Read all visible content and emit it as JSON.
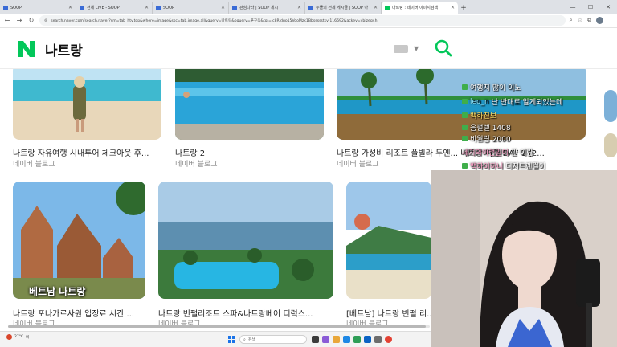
{
  "browser": {
    "tabs": [
      {
        "label": "SOOP",
        "favicon": "soop-icon",
        "active": false
      },
      {
        "label": "전체 LIVE - SOOP",
        "favicon": "soop-icon",
        "active": false
      },
      {
        "label": "SOOP",
        "favicon": "soop-icon",
        "active": false
      },
      {
        "label": "관심나라 | SOOP 게시",
        "favicon": "soop-icon",
        "active": false
      },
      {
        "label": "두들의 전체 게시글 | SOOP 아",
        "favicon": "soop-icon",
        "active": false
      },
      {
        "label": "나트랑 : 네이버 이미지검색",
        "favicon": "naver-icon",
        "active": true
      }
    ],
    "new_tab_label": "+",
    "url": "search.naver.com/search.naver?sm=tab_hty.top&where=image&ssc=tab.image.all&query=나트랑&oquery=푸꾸옥&tqi=jc8Rldqo15VooMzk1Bbssssstsv-116692&ackey=ybizeg4h"
  },
  "naver": {
    "logo": "N",
    "query": "나트랑",
    "brand_color": "#03c75a"
  },
  "results": [
    {
      "title": "나트랑 자유여행 시내투어 체크아웃 후...",
      "source": "네이버 블로그"
    },
    {
      "title": "나트랑 2",
      "source": "네이버 블로그"
    },
    {
      "title": "나트랑 가성비 리조트 풀빌라 두엔... 나트랑 여행 DAY 1 (2...",
      "source": "네이버 블로그"
    },
    {
      "title": "나트랑 포나가르사원 입장료 시간 ...",
      "source": "네이버 블로그",
      "overlay": "베트남 나트랑"
    },
    {
      "title": "나트랑 빈펄리조트 스파&나트랑베이 디럭스...",
      "source": "네이버 블로그"
    },
    {
      "title": "[베트남] 나트랑 빈펄 리...",
      "source": "네이버 블로그"
    }
  ],
  "chat": [
    {
      "nick": "",
      "msg": "여행지 많이 이노"
    },
    {
      "nick": "leo_n",
      "msg": "난 반대로 알게되었는데"
    },
    {
      "nick": "백하진보",
      "msg": ""
    },
    {
      "nick": "",
      "msg": "음펄렐 1408"
    },
    {
      "nick": "",
      "msg": "비월링 2000"
    },
    {
      "nick": "세기의이런일이",
      "msg": "관 이란"
    },
    {
      "nick": "백하이하니",
      "msg": "디저트렌걸이"
    }
  ],
  "taskbar": {
    "weather": "27°C",
    "weather_sub": "비",
    "search_placeholder": "검색"
  }
}
